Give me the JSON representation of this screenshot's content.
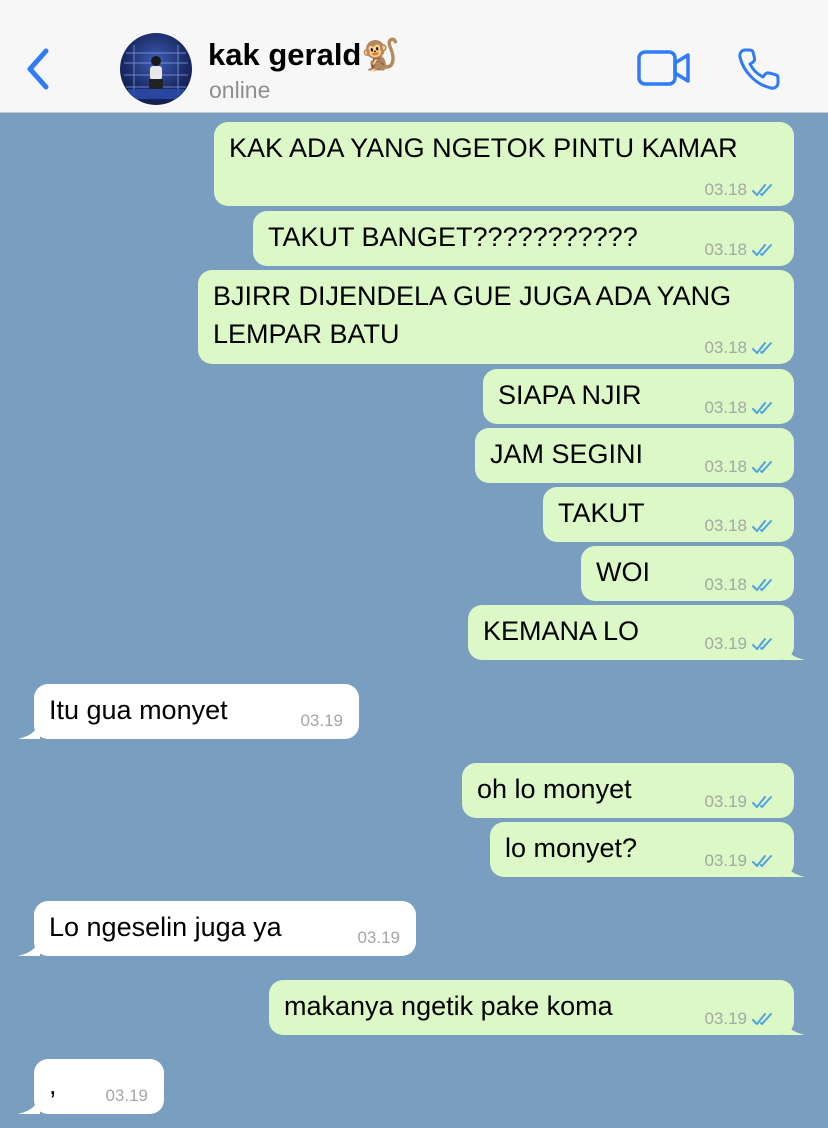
{
  "header": {
    "back_icon": "chevron-left-icon",
    "contact_name": "kak gerald🐒",
    "status": "online",
    "video_icon": "video-camera-icon",
    "call_icon": "phone-icon",
    "accent_color": "#2f7cf6"
  },
  "colors": {
    "chat_background": "#7a9ebf",
    "outgoing_bubble": "#dcf8c6",
    "incoming_bubble": "#ffffff",
    "read_ticks": "#4fa3e0"
  },
  "messages": [
    {
      "direction": "out",
      "text": "KAK ADA YANG NGETOK PINTU KAMAR",
      "time": "03.18",
      "status": "read"
    },
    {
      "direction": "out",
      "text": "TAKUT BANGET???????????",
      "time": "03.18",
      "status": "read"
    },
    {
      "direction": "out",
      "text": "BJIRR DIJENDELA GUE JUGA ADA YANG LEMPAR BATU",
      "time": "03.18",
      "status": "read"
    },
    {
      "direction": "out",
      "text": "SIAPA NJIR",
      "time": "03.18",
      "status": "read"
    },
    {
      "direction": "out",
      "text": "JAM SEGINI",
      "time": "03.18",
      "status": "read"
    },
    {
      "direction": "out",
      "text": "TAKUT",
      "time": "03.18",
      "status": "read"
    },
    {
      "direction": "out",
      "text": "WOI",
      "time": "03.18",
      "status": "read"
    },
    {
      "direction": "out",
      "text": "KEMANA LO",
      "time": "03.19",
      "status": "read"
    },
    {
      "direction": "in",
      "text": "Itu gua monyet",
      "time": "03.19"
    },
    {
      "direction": "out",
      "text": "oh lo monyet",
      "time": "03.19",
      "status": "read"
    },
    {
      "direction": "out",
      "text": "lo monyet?",
      "time": "03.19",
      "status": "read"
    },
    {
      "direction": "in",
      "text": "Lo ngeselin juga ya",
      "time": "03.19"
    },
    {
      "direction": "out",
      "text": "makanya ngetik pake koma",
      "time": "03.19",
      "status": "read"
    },
    {
      "direction": "in",
      "text": ",",
      "time": "03.19"
    }
  ]
}
